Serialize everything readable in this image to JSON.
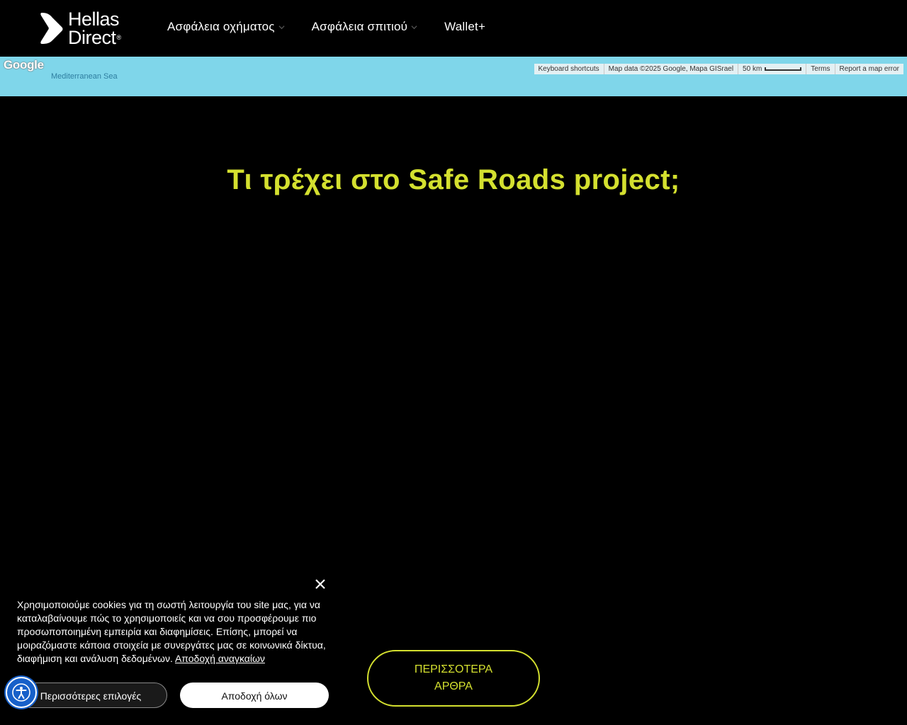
{
  "brand": {
    "line1": "Hellas",
    "line2": "Direct",
    "registered": "®"
  },
  "nav": {
    "items": [
      {
        "label": "Ασφάλεια οχήματος",
        "has_dropdown": true
      },
      {
        "label": "Ασφάλεια σπιτιού",
        "has_dropdown": true
      },
      {
        "label": "Wallet+",
        "has_dropdown": false
      }
    ]
  },
  "map": {
    "logo": "Google",
    "place_label": "Mediterranean Sea",
    "attribution": {
      "shortcuts": "Keyboard shortcuts",
      "data": "Map data ©2025 Google, Mapa GISrael",
      "scale": "50 km",
      "terms": "Terms",
      "report": "Report a map error"
    }
  },
  "main": {
    "title": "Τι τρέχει στο Safe Roads project;",
    "more_button": "ΠΕΡΙΣΣΟΤΕΡΑ ΑΡΘΡΑ"
  },
  "cookie": {
    "close_icon": "×",
    "text": "Χρησιμοποιούμε cookies για τη σωστή λειτουργία του site μας, για να καταλαβαίνουμε πώς το χρησιμοποιείς και να σου προσφέρουμε πιο προσωποποιημένη εμπειρία και διαφημίσεις. Επίσης, μπορεί να μοιραζόμαστε κάποια στοιχεία με συνεργάτες μας σε κοινωνικά δίκτυα, διαφήμιση και ανάλυση δεδομένων.",
    "link": "Αποδοχή αναγκαίων",
    "options_button": "Περισσότερες επιλογές",
    "accept_button": "Αποδοχή όλων"
  },
  "colors": {
    "accent": "#d4e02f",
    "background": "#000000",
    "map_water": "#7fd6ea",
    "a11y_blue": "#1760c9"
  },
  "icons": {
    "logo_mark": "chevron-right-logo-icon",
    "nav_dropdown": "chevron-down-icon",
    "close": "close-icon",
    "accessibility": "accessibility-person-icon"
  }
}
